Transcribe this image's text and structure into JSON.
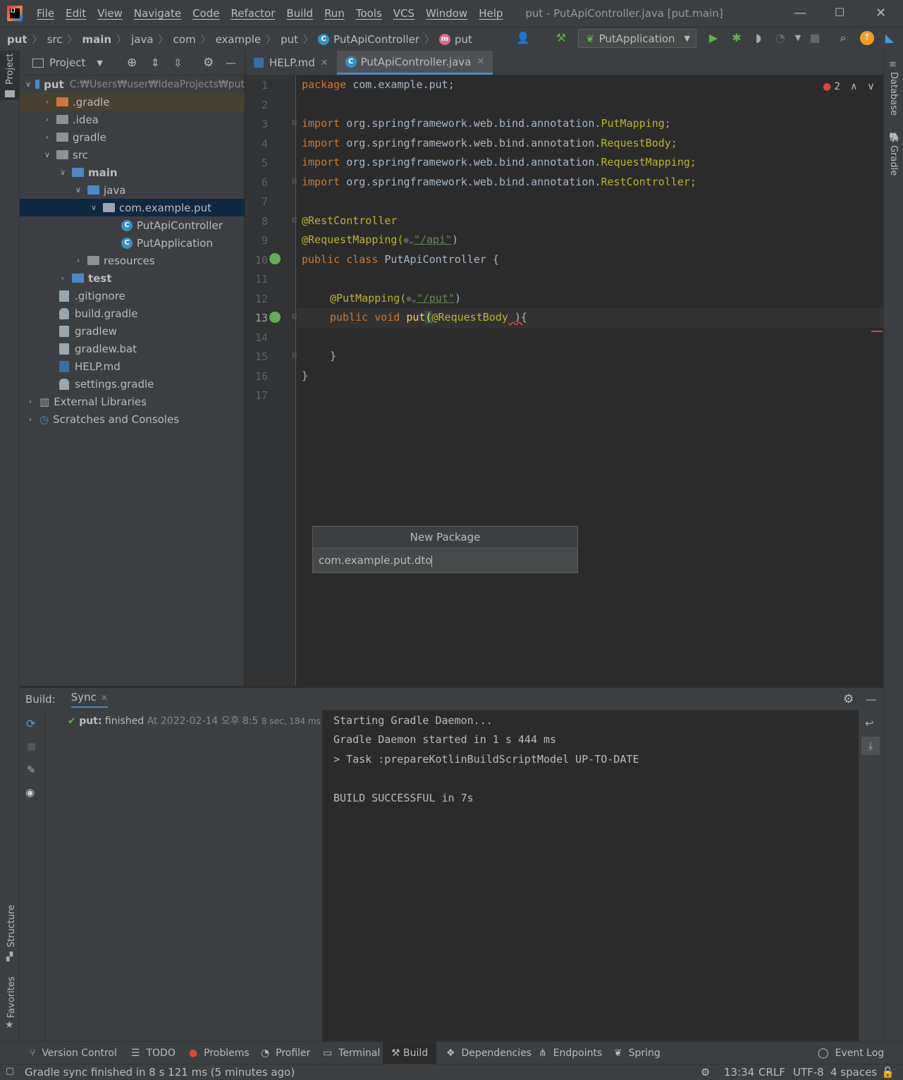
{
  "menubar": {
    "items": [
      "File",
      "Edit",
      "View",
      "Navigate",
      "Code",
      "Refactor",
      "Build",
      "Run",
      "Tools",
      "VCS",
      "Window",
      "Help"
    ],
    "title": "put - PutApiController.java [put.main]"
  },
  "breadcrumb": [
    "put",
    "src",
    "main",
    "java",
    "com",
    "example",
    "put",
    "PutApiController",
    "put"
  ],
  "run_config": "PutApplication",
  "project_panel": {
    "title": "Project",
    "root_name": "put",
    "root_path": "C:₩Users₩user₩IdeaProjects₩put",
    "items": [
      ".gradle",
      ".idea",
      "gradle",
      "src",
      "main",
      "java",
      "com.example.put",
      "PutApiController",
      "PutApplication",
      "resources",
      "test",
      ".gitignore",
      "build.gradle",
      "gradlew",
      "gradlew.bat",
      "HELP.md",
      "settings.gradle",
      "External Libraries",
      "Scratches and Consoles"
    ]
  },
  "tabs": [
    "HELP.md",
    "PutApiController.java"
  ],
  "editor": {
    "error_count": "2",
    "lines": [
      "1",
      "2",
      "3",
      "4",
      "5",
      "6",
      "7",
      "8",
      "9",
      "10",
      "11",
      "12",
      "13",
      "14",
      "15",
      "16",
      "17"
    ],
    "pkg_kw": "package",
    "pkg_name": " com.example.put;",
    "import_kw": "import",
    "import_prefix": " org.springframework.web.bind.annotation.",
    "imports": [
      "PutMapping;",
      "RequestBody;",
      "RequestMapping;",
      "RestController;"
    ],
    "anno_rest": "@RestController",
    "anno_reqmap": "@RequestMapping(",
    "api_path": "\"/api\"",
    "close_paren": ")",
    "class_kw": "public class",
    "class_name": " PutApiController {",
    "anno_put": "@PutMapping(",
    "put_path": "\"/put\"",
    "method_kw": "public void",
    "method_name": " put",
    "method_open": "(",
    "method_anno": "@RequestBody",
    "method_close": " ){",
    "brace_inner": "}",
    "brace_outer": "}"
  },
  "dialog": {
    "title": "New Package",
    "value": "com.example.put.dto"
  },
  "build": {
    "label": "Build:",
    "tab": "Sync",
    "tree_item_name": "put:",
    "tree_item_status": "finished",
    "tree_item_time": "At 2022-02-14 오후 8:5",
    "tree_item_duration": "8 sec, 184 ms",
    "output": [
      "Starting Gradle Daemon...",
      "Gradle Daemon started in 1 s 444 ms",
      "> Task :prepareKotlinBuildScriptModel UP-TO-DATE",
      "",
      "BUILD SUCCESSFUL in 7s"
    ]
  },
  "side_labels": {
    "project": "Project",
    "structure": "Structure",
    "favorites": "Favorites",
    "database": "Database",
    "gradle": "Gradle"
  },
  "bottom_tabs": [
    "Version Control",
    "TODO",
    "Problems",
    "Profiler",
    "Terminal",
    "Build",
    "Dependencies",
    "Endpoints",
    "Spring",
    "Event Log"
  ],
  "status": {
    "message": "Gradle sync finished in 8 s 121 ms (5 minutes ago)",
    "position": "13:34",
    "line_sep": "CRLF",
    "encoding": "UTF-8",
    "indent": "4 spaces"
  },
  "colors": {
    "accent": "#4a88c7",
    "keyword": "#cc7832",
    "annotation": "#bbb529",
    "string": "#6a8759",
    "error": "#e0433f",
    "success": "#5fb04b"
  }
}
